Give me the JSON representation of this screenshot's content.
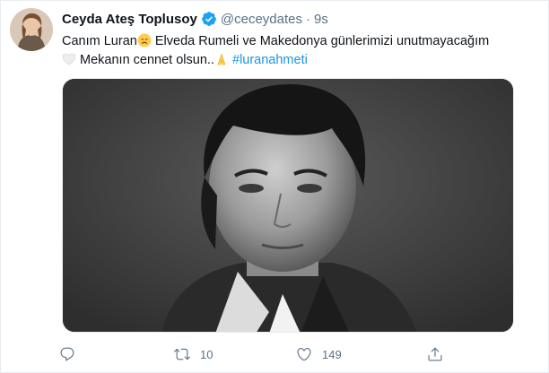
{
  "tweet": {
    "display_name": "Ceyda Ateş Toplusoy",
    "handle": "@ceceydates",
    "separator": "·",
    "time": "9s",
    "text_line1_a": "Canım Luran",
    "text_line1_b": " Elveda Rumeli ve Makedonya günlerimizi unutmayacağım",
    "text_line2_a": " Mekanın cennet olsun..",
    "hashtag": "#luranahmeti",
    "verified": true,
    "accent_color": "#1da1f2",
    "icons": {
      "avatar": "profile-avatar",
      "verified": "verified-badge-icon",
      "emoji_1": "disappointed-face-emoji",
      "emoji_2": "white-heart-emoji",
      "emoji_3": "folded-hands-emoji"
    }
  },
  "media": {
    "description_icon": "black-and-white-portrait-photo"
  },
  "actions": {
    "reply_count": "",
    "retweet_count": "10",
    "like_count": "149",
    "share_count": "",
    "icons": [
      "reply-icon",
      "retweet-icon",
      "like-icon",
      "share-icon"
    ]
  }
}
